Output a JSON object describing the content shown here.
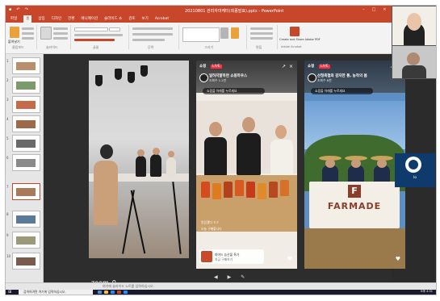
{
  "app": {
    "title": "20210801 관리자마케터(최종발표).pptx - PowerPoint",
    "tabs": [
      "파일",
      "홈",
      "삽입",
      "디자인",
      "전환",
      "애니메이션",
      "슬라이드 쇼",
      "검토",
      "보기",
      "Acrobat"
    ],
    "active_tab": "홈",
    "status_text": "여기에 슬라이드 노트를 입력하십시오."
  },
  "ribbon": {
    "groups": [
      "클립보드",
      "슬라이드",
      "글꼴",
      "단락",
      "그리기",
      "편집",
      "Adobe Acrobat"
    ],
    "paste_label": "붙여넣기",
    "acrobat_label": "Create and Share Adobe PDF"
  },
  "thumbnails": [
    {
      "num": "1"
    },
    {
      "num": "2"
    },
    {
      "num": "3"
    },
    {
      "num": "4"
    },
    {
      "num": "5"
    },
    {
      "num": "6"
    },
    {
      "num": "7"
    },
    {
      "num": "8"
    },
    {
      "num": "9"
    },
    {
      "num": "10"
    }
  ],
  "phone1": {
    "channel": "쇼핑",
    "live": "LIVE",
    "name": "일하지말하면 쇼핑하우스",
    "sub": "조회수 1.2만",
    "notice": "쇼핑을 아래를 누르세요",
    "chat": [
      "맛있겠다 ㅎㅎ",
      "오늘 구매합니다"
    ],
    "product_title": "파머드 농산물 특가",
    "product_sub": "지금 구매하기"
  },
  "phone2": {
    "channel": "쇼핑",
    "live": "LIVE",
    "name": "산청축협와 감자한 통, 농작의 봄",
    "sub": "조회수 8천",
    "notice": "쇼핑을 아래를 누르세요",
    "brand": "FARMADE"
  },
  "zoom": {
    "label": "zoom_0",
    "obs_label": "lo"
  },
  "taskbar": {
    "search": "검색하려면 여기에 입력하십시오.",
    "clock": "오후 4:31"
  },
  "colors": {
    "ppt_accent": "#c8472b",
    "live_red": "#ff3040",
    "farmade_brown": "#8a3d2a"
  }
}
